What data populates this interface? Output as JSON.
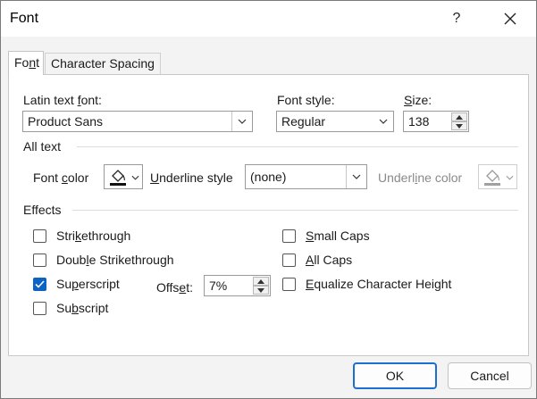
{
  "window": {
    "title": "Font",
    "help": "?",
    "close_icon": "close-icon"
  },
  "tabs": [
    {
      "label": "Font",
      "underline_index": 2,
      "active": true
    },
    {
      "label": "Character Spacing",
      "active": false
    }
  ],
  "font_section": {
    "latin_label": "Latin text font:",
    "latin_value": "Product Sans",
    "style_label": "Font style:",
    "style_value": "Regular",
    "size_label": "Size:",
    "size_value": "138"
  },
  "all_text": {
    "title": "All text",
    "font_color_label": "Font color",
    "underline_style_label": "Underline style",
    "underline_style_value": "(none)",
    "underline_color_label": "Underline color"
  },
  "effects": {
    "title": "Effects",
    "items": [
      {
        "label": "Strikethrough",
        "checked": false
      },
      {
        "label": "Double Strikethrough",
        "checked": false
      },
      {
        "label": "Superscript",
        "checked": true
      },
      {
        "label": "Subscript",
        "checked": false
      },
      {
        "label": "Small Caps",
        "checked": false
      },
      {
        "label": "All Caps",
        "checked": false
      },
      {
        "label": "Equalize Character Height",
        "checked": false
      }
    ],
    "offset_label": "Offset:",
    "offset_value": "7%"
  },
  "buttons": {
    "ok": "OK",
    "cancel": "Cancel"
  },
  "colors": {
    "accent": "#0b63c5",
    "panel_bg": "#ffffff",
    "dialog_bg": "#f3f3f3"
  }
}
